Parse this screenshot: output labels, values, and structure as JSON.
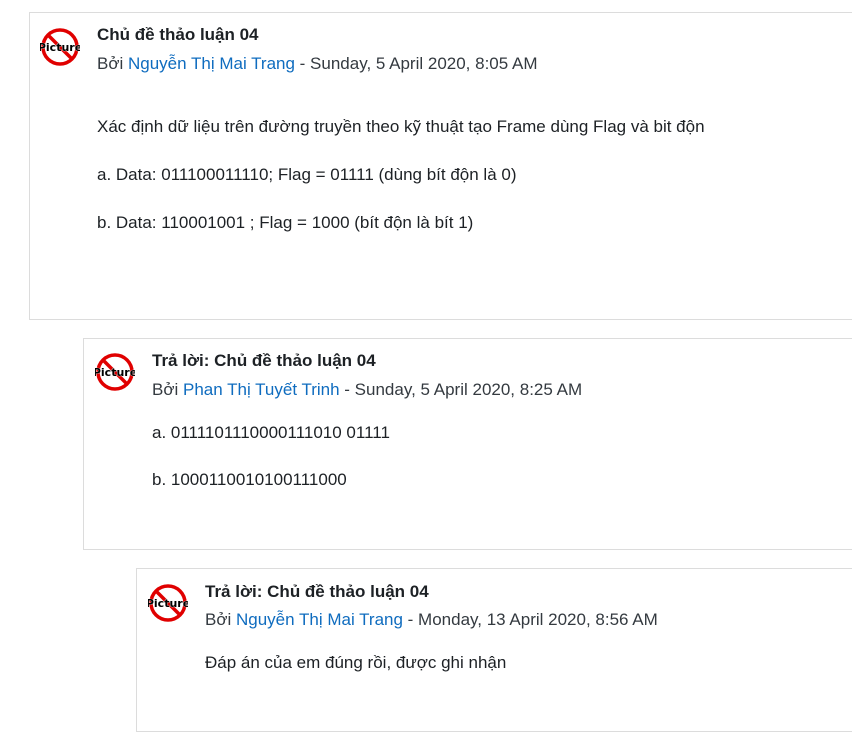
{
  "posts": [
    {
      "avatar_icon": "no-picture-icon",
      "avatar_text": "Picture",
      "subject": "Chủ đề thảo luận 04",
      "by_prefix": "Bởi ",
      "author": "Nguyễn Thị Mai Trang",
      "date": " - Sunday, 5 April 2020, 8:05 AM",
      "paragraphs": [
        "Xác định dữ liệu trên đường truyền theo kỹ thuật tạo Frame dùng Flag và bit độn",
        "a. Data: 011100011110; Flag = 01111 (dùng bít độn là 0)",
        "b. Data: 110001001 ; Flag = 1000 (bít độn là bít 1)"
      ]
    },
    {
      "avatar_icon": "no-picture-icon",
      "avatar_text": "Picture",
      "subject": "Trả lời: Chủ đề thảo luận 04",
      "by_prefix": "Bởi ",
      "author": "Phan Thị Tuyết Trinh",
      "date": " - Sunday, 5 April 2020, 8:25 AM",
      "paragraphs": [
        "a. 0111101110000111010 01111",
        "b. 1000110010100111000"
      ]
    },
    {
      "avatar_icon": "no-picture-icon",
      "avatar_text": "Picture",
      "subject": "Trả lời: Chủ đề thảo luận 04",
      "by_prefix": "Bởi ",
      "author": "Nguyễn Thị Mai Trang",
      "date": " - Monday, 13 April 2020, 8:56 AM",
      "paragraphs": [
        "Đáp án của em đúng rồi, được ghi nhận"
      ]
    }
  ]
}
